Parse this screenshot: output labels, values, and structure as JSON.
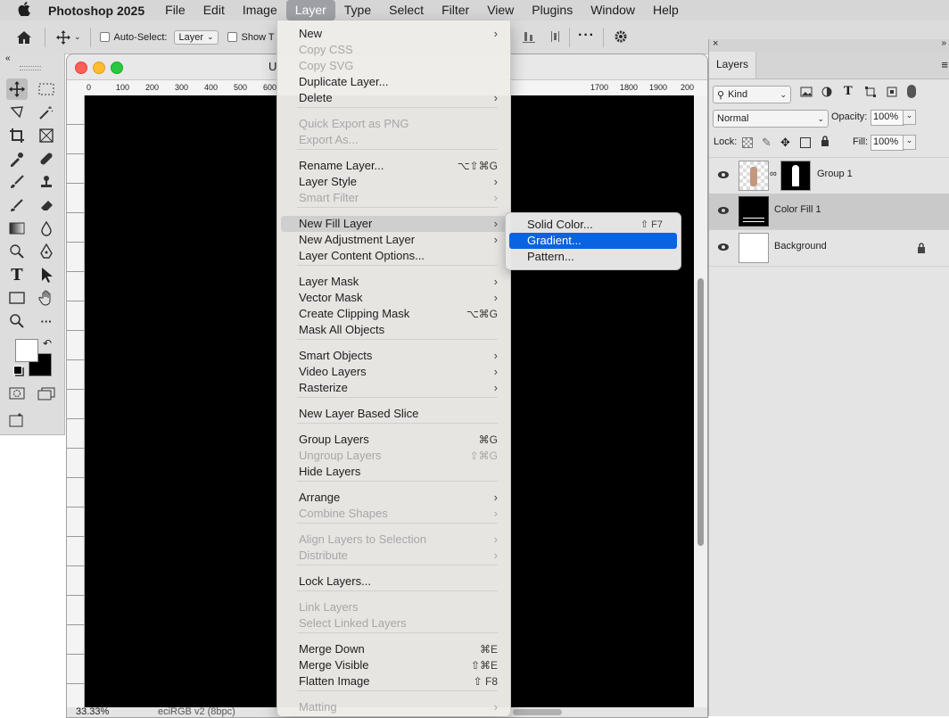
{
  "menubar": {
    "app_name": "Photoshop 2025",
    "menus": [
      "File",
      "Edit",
      "Image",
      "Layer",
      "Type",
      "Select",
      "Filter",
      "View",
      "Plugins",
      "Window",
      "Help"
    ]
  },
  "options_bar": {
    "auto_select_label": "Auto-Select:",
    "auto_select_value": "Layer",
    "show_label": "Show T"
  },
  "document": {
    "title_partial": "U",
    "ruler_ticks": [
      "0",
      "100",
      "200",
      "300",
      "400",
      "500",
      "600",
      "1700",
      "1800",
      "1900",
      "200"
    ],
    "zoom": "33.33%",
    "color_profile": "eciRGB v2 (8bpc)"
  },
  "layer_menu": {
    "items": [
      {
        "label": "New",
        "submenu": true
      },
      {
        "label": "Copy CSS",
        "disabled": true
      },
      {
        "label": "Copy SVG",
        "disabled": true
      },
      {
        "label": "Duplicate Layer..."
      },
      {
        "label": "Delete",
        "submenu": true
      },
      {
        "label": "Quick Export as PNG",
        "disabled": true
      },
      {
        "label": "Export As...",
        "disabled": true
      },
      {
        "label": "Rename Layer...",
        "shortcut": "⌥⇧⌘G"
      },
      {
        "label": "Layer Style",
        "submenu": true
      },
      {
        "label": "Smart Filter",
        "submenu": true,
        "disabled": true
      },
      {
        "label": "New Fill Layer",
        "submenu": true,
        "highlighted": true
      },
      {
        "label": "New Adjustment Layer",
        "submenu": true
      },
      {
        "label": "Layer Content Options..."
      },
      {
        "label": "Layer Mask",
        "submenu": true
      },
      {
        "label": "Vector Mask",
        "submenu": true
      },
      {
        "label": "Create Clipping Mask",
        "shortcut": "⌥⌘G"
      },
      {
        "label": "Mask All Objects"
      },
      {
        "label": "Smart Objects",
        "submenu": true
      },
      {
        "label": "Video Layers",
        "submenu": true
      },
      {
        "label": "Rasterize",
        "submenu": true
      },
      {
        "label": "New Layer Based Slice"
      },
      {
        "label": "Group Layers",
        "shortcut": "⌘G"
      },
      {
        "label": "Ungroup Layers",
        "shortcut": "⇧⌘G",
        "disabled": true
      },
      {
        "label": "Hide Layers"
      },
      {
        "label": "Arrange",
        "submenu": true
      },
      {
        "label": "Combine Shapes",
        "submenu": true,
        "disabled": true
      },
      {
        "label": "Align Layers to Selection",
        "submenu": true,
        "disabled": true
      },
      {
        "label": "Distribute",
        "submenu": true,
        "disabled": true
      },
      {
        "label": "Lock Layers..."
      },
      {
        "label": "Link Layers",
        "disabled": true
      },
      {
        "label": "Select Linked Layers",
        "disabled": true
      },
      {
        "label": "Merge Down",
        "shortcut": "⌘E"
      },
      {
        "label": "Merge Visible",
        "shortcut": "⇧⌘E"
      },
      {
        "label": "Flatten Image",
        "shortcut": "⇧ F8"
      },
      {
        "label": "Matting",
        "submenu": true,
        "disabled": true
      }
    ]
  },
  "fill_submenu": {
    "items": [
      {
        "label": "Solid Color...",
        "shortcut": "⇧ F7"
      },
      {
        "label": "Gradient...",
        "selected": true
      },
      {
        "label": "Pattern..."
      }
    ]
  },
  "layers_panel": {
    "tab": "Layers",
    "filter_kind": "Kind",
    "blend_mode": "Normal",
    "opacity_label": "Opacity:",
    "opacity": "100%",
    "lock_label": "Lock:",
    "fill_label": "Fill:",
    "fill": "100%",
    "layers": [
      {
        "name": "Group 1"
      },
      {
        "name": "Color Fill 1",
        "selected": true
      },
      {
        "name": "Background",
        "locked": true
      }
    ]
  },
  "colors": {
    "accent": "#0a63e0",
    "canvas": "#000000"
  }
}
